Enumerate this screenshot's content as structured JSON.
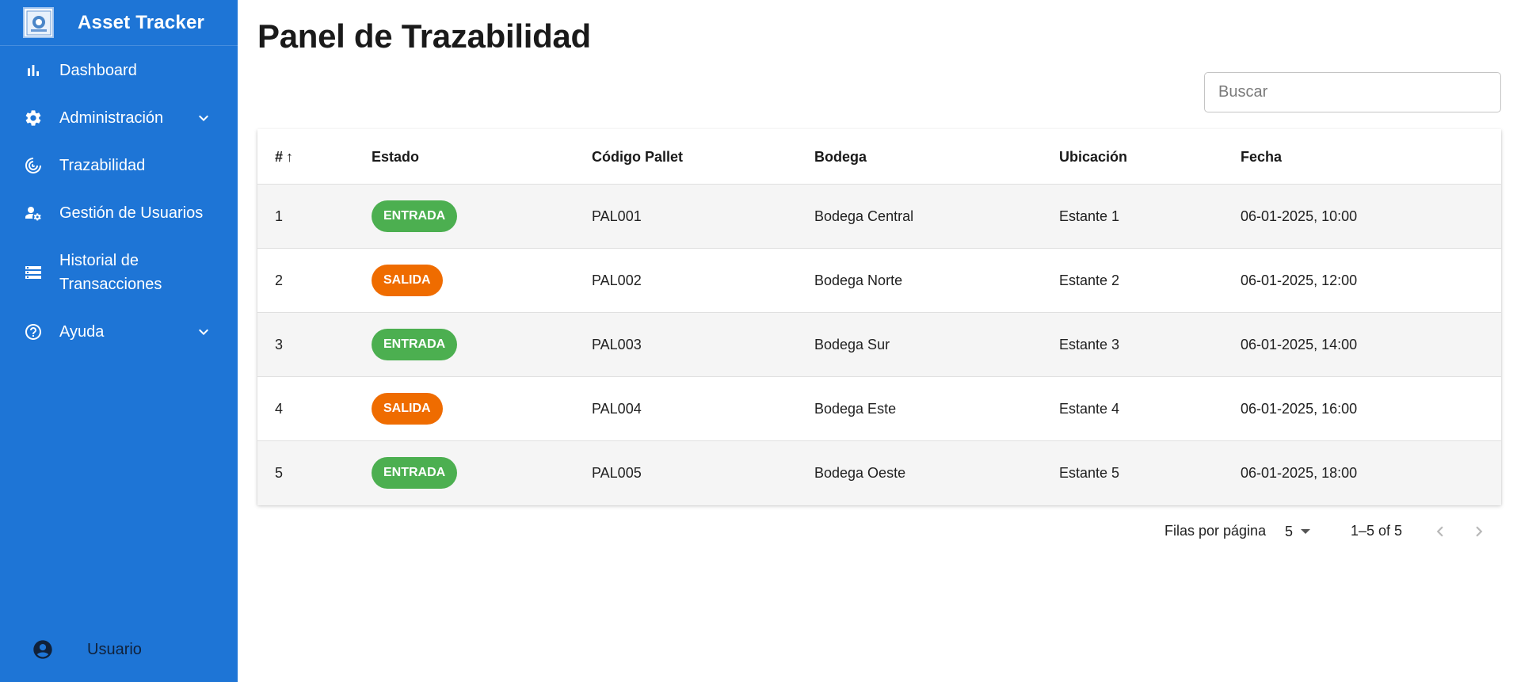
{
  "app": {
    "title": "Asset Tracker"
  },
  "sidebar": {
    "items": [
      {
        "label": "Dashboard",
        "icon": "bar-chart-icon"
      },
      {
        "label": "Administración",
        "icon": "gear-icon",
        "expandable": true
      },
      {
        "label": "Trazabilidad",
        "icon": "radar-icon"
      },
      {
        "label": "Gestión de Usuarios",
        "icon": "user-settings-icon"
      },
      {
        "label_line1": "Historial de",
        "label_line2": "Transacciones",
        "icon": "storage-icon"
      },
      {
        "label": "Ayuda",
        "icon": "help-circle-icon",
        "expandable": true
      }
    ],
    "user_label": "Usuario"
  },
  "page": {
    "title": "Panel de Trazabilidad"
  },
  "search": {
    "placeholder": "Buscar"
  },
  "table": {
    "headers": {
      "num": "#",
      "sort_indicator": "↑",
      "estado": "Estado",
      "codigo": "Código Pallet",
      "bodega": "Bodega",
      "ubicacion": "Ubicación",
      "fecha": "Fecha"
    },
    "rows": [
      {
        "num": "1",
        "estado": "ENTRADA",
        "codigo": "PAL001",
        "bodega": "Bodega Central",
        "ubicacion": "Estante 1",
        "fecha": "06-01-2025, 10:00"
      },
      {
        "num": "2",
        "estado": "SALIDA",
        "codigo": "PAL002",
        "bodega": "Bodega Norte",
        "ubicacion": "Estante 2",
        "fecha": "06-01-2025, 12:00"
      },
      {
        "num": "3",
        "estado": "ENTRADA",
        "codigo": "PAL003",
        "bodega": "Bodega Sur",
        "ubicacion": "Estante 3",
        "fecha": "06-01-2025, 14:00"
      },
      {
        "num": "4",
        "estado": "SALIDA",
        "codigo": "PAL004",
        "bodega": "Bodega Este",
        "ubicacion": "Estante 4",
        "fecha": "06-01-2025, 16:00"
      },
      {
        "num": "5",
        "estado": "ENTRADA",
        "codigo": "PAL005",
        "bodega": "Bodega Oeste",
        "ubicacion": "Estante 5",
        "fecha": "06-01-2025, 18:00"
      }
    ]
  },
  "pagination": {
    "rows_label": "Filas por página",
    "rows_value": "5",
    "range": "1–5 of 5"
  },
  "colors": {
    "sidebar": "#1e75d6",
    "entrada": "#4caf50",
    "salida": "#ef6c00"
  }
}
